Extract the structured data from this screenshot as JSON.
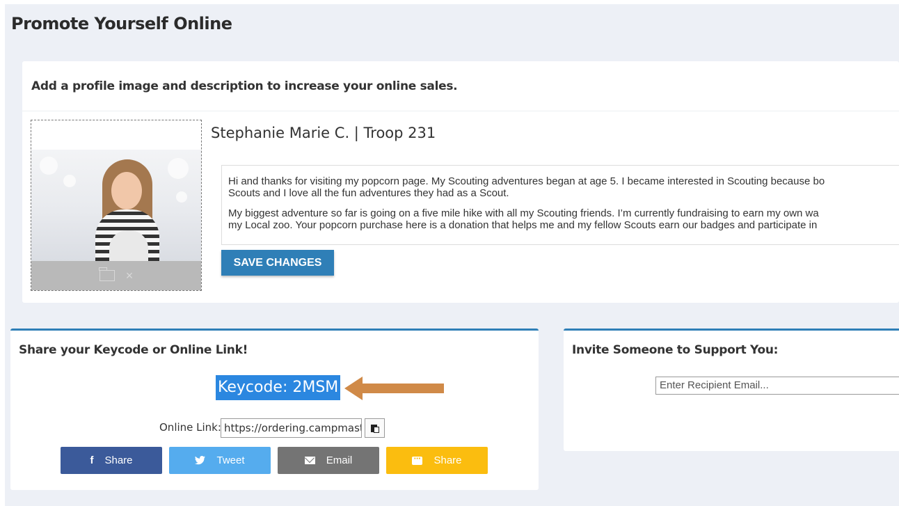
{
  "page": {
    "title": "Promote Yourself Online"
  },
  "profile": {
    "heading": "Add a profile image and description to increase your online sales.",
    "name": "Stephanie Marie C. | Troop 231",
    "description_p1": "Hi and thanks for visiting my popcorn page. My Scouting adventures began at age 5. I became interested in Scouting because bo",
    "description_p1b": "Scouts and I love all the fun adventures they had as a Scout.",
    "description_p2": "My biggest adventure so far is going on a five mile hike with all my Scouting friends. I’m currently fundraising to earn my own wa",
    "description_p2b": "my Local zoo. Your popcorn purchase here is a donation that helps me and my fellow Scouts earn our badges and participate in",
    "save_label": "SAVE CHANGES",
    "uploader_icons": [
      "folder-icon",
      "close-icon"
    ]
  },
  "share": {
    "heading": "Share your Keycode or Online Link!",
    "keycode": "Keycode: 2MSM",
    "online_link_label": "Online Link:",
    "online_link_value": "https://ordering.campmast",
    "buttons": [
      {
        "label": "Share",
        "icon": "facebook-icon",
        "color": "#3b5a9a"
      },
      {
        "label": "Tweet",
        "icon": "twitter-icon",
        "color": "#55acee"
      },
      {
        "label": "Email",
        "icon": "email-icon",
        "color": "#747474"
      },
      {
        "label": "Share",
        "icon": "sms-icon",
        "color": "#fbbd0f"
      }
    ]
  },
  "invite": {
    "heading": "Invite Someone to Support You:",
    "placeholder": "Enter Recipient Email..."
  },
  "colors": {
    "accent": "#2f7fb7",
    "highlight": "#2b87e0",
    "arrow": "#d08a48",
    "background": "#edf0f6"
  }
}
